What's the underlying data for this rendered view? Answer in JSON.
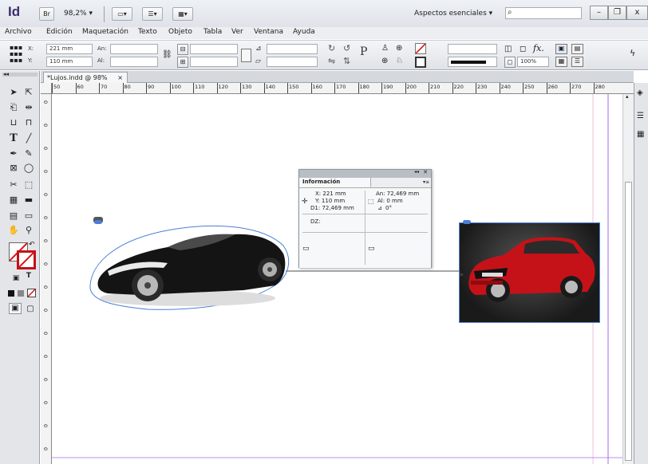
{
  "app": {
    "logo": "Id",
    "bridge_btn": "Br",
    "zoom": "98,2%",
    "workspace": "Aspectos esenciales",
    "workspace_arrow": "▾",
    "search_placeholder": "",
    "search_icon": "⌕",
    "minimize": "–",
    "restore": "❐",
    "close": "x"
  },
  "menu": [
    "Archivo",
    "Edición",
    "Maquetación",
    "Texto",
    "Objeto",
    "Tabla",
    "Ver",
    "Ventana",
    "Ayuda"
  ],
  "control": {
    "x_label": "X:",
    "x_value": "221 mm",
    "y_label": "Y:",
    "y_value": "110 mm",
    "w_label": "An:",
    "h_label": "Al:",
    "zoom_field": "100%"
  },
  "document": {
    "tab": "*Lujos.indd @ 98%",
    "tab_close": "×"
  },
  "ruler": {
    "h_ticks": [
      "50",
      "60",
      "70",
      "80",
      "90",
      "100",
      "110",
      "120",
      "130",
      "140",
      "150",
      "160",
      "170",
      "180",
      "190",
      "200",
      "210",
      "220",
      "230",
      "240",
      "250",
      "260",
      "270",
      "280"
    ],
    "v_ticks": [
      "0",
      "0",
      "0",
      "0",
      "0",
      "0",
      "0",
      "0",
      "0",
      "0",
      "0",
      "0",
      "0",
      "0",
      "0",
      "0"
    ]
  },
  "info_panel": {
    "title": "Información",
    "x": "X: 221 mm",
    "y": "Y: 110 mm",
    "d": "D1: 72,469 mm",
    "an": "An: 72,469 mm",
    "al": "Al: 0 mm",
    "angle": "0°",
    "dz": "DZ:"
  },
  "icons": {
    "selection": "selection-tool-icon",
    "direct": "direct-selection-icon",
    "pen": "pen-tool-icon",
    "type": "type-tool-icon",
    "hand": "hand-tool-icon",
    "zoom": "zoom-tool-icon"
  },
  "colors": {
    "accent": "#3d2e6e",
    "guide": "#a56bf0",
    "selection": "#4a7fd4",
    "car_red": "#c41218"
  }
}
